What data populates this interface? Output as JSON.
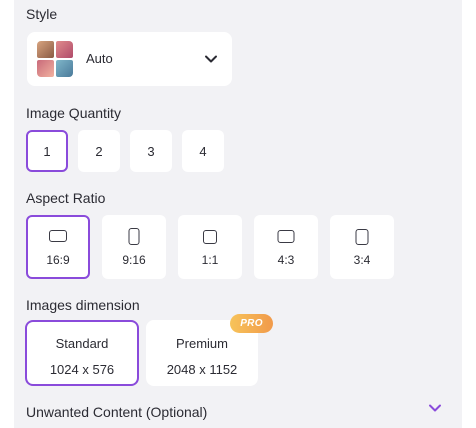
{
  "style": {
    "label": "Style",
    "selected": "Auto"
  },
  "quantity": {
    "label": "Image Quantity",
    "options": [
      "1",
      "2",
      "3",
      "4"
    ],
    "selected": "1"
  },
  "aspect_ratio": {
    "label": "Aspect Ratio",
    "options": [
      "16:9",
      "9:16",
      "1:1",
      "4:3",
      "3:4"
    ],
    "selected": "16:9"
  },
  "dimension": {
    "label": "Images dimension",
    "options": [
      {
        "name": "Standard",
        "size": "1024 x 576"
      },
      {
        "name": "Premium",
        "size": "2048 x 1152"
      }
    ],
    "selected": "Standard",
    "pro_badge": "PRO"
  },
  "unwanted": {
    "label": "Unwanted Content (Optional)"
  },
  "colors": {
    "accent": "#8a4bdb",
    "panel_bg": "#f2f2f5",
    "pro_badge": "#f4ab4f"
  },
  "icons": {
    "style_chevron": "chevron-down-icon",
    "unwanted_chevron": "chevron-down-icon"
  }
}
